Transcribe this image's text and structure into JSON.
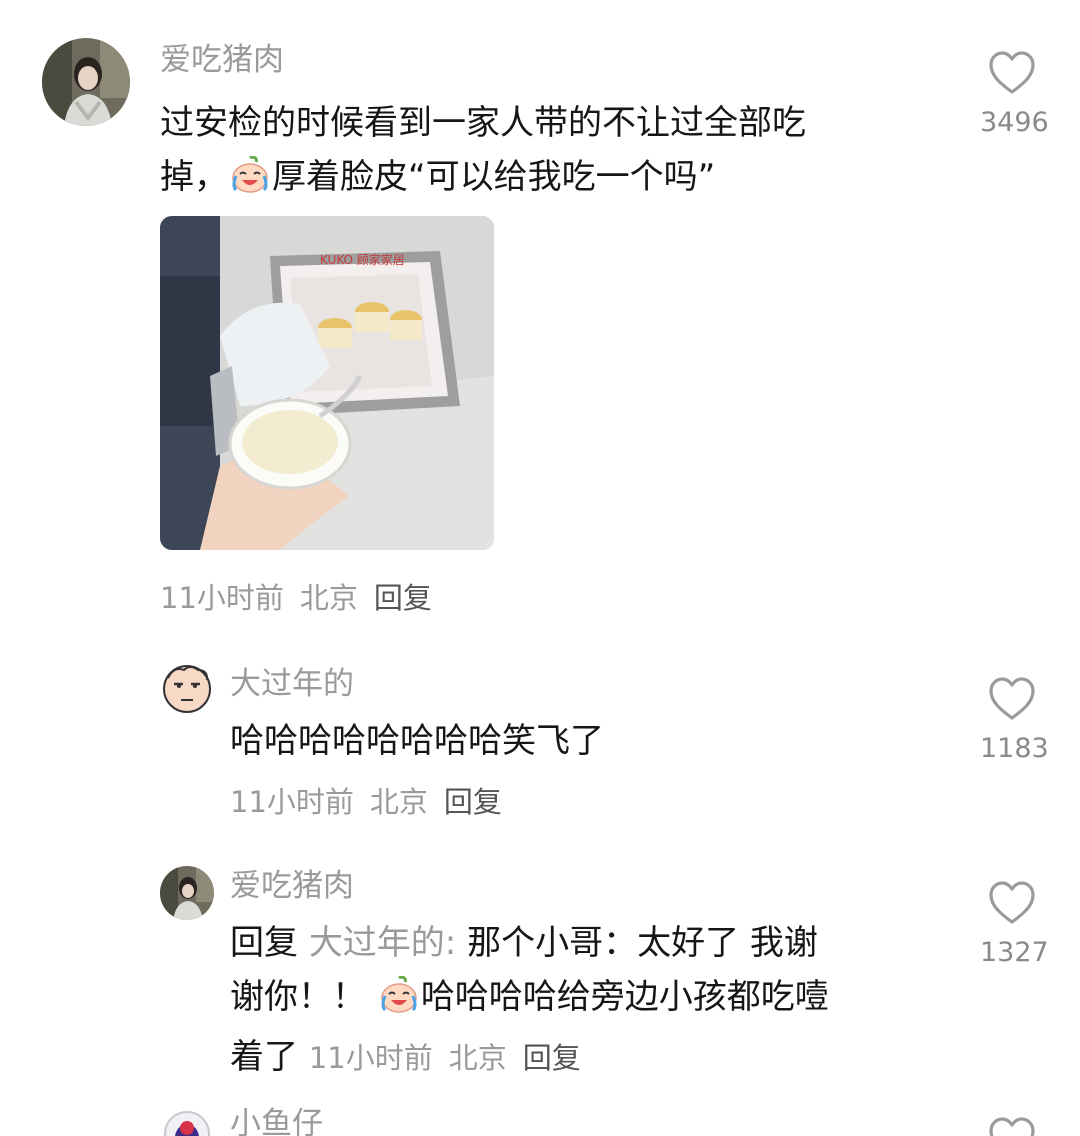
{
  "comments": [
    {
      "username": "爱吃猪肉",
      "text_line1": "过安检的时候看到一家人带的不让过全部吃",
      "text_line2_a": "掉，",
      "text_line2_b": "厚着脸皮“可以给我吃一个吗”",
      "emoji": "crying-laughing-emoji",
      "image": {
        "brand_text": "KUKO 顾家家居"
      },
      "time": "11小时前",
      "location": "北京",
      "reply_label": "回复",
      "likes": "3496"
    }
  ],
  "replies": [
    {
      "username": "大过年的",
      "text": "哈哈哈哈哈哈哈哈笑飞了",
      "time": "11小时前",
      "location": "北京",
      "reply_label": "回复",
      "likes": "1183"
    },
    {
      "username": "爱吃猪肉",
      "reply_prefix": "回复",
      "reply_target": "大过年的:",
      "text_line1": "那个小哥：太好了 我谢",
      "text_line2_a": "谢你！！",
      "text_line2_b": "哈哈哈哈给旁边小孩都吃噎",
      "text_line3": "着了",
      "emoji": "crying-laughing-emoji",
      "time": "11小时前",
      "location": "北京",
      "reply_label": "回复",
      "likes": "1327"
    },
    {
      "username": "小鱼仔"
    }
  ],
  "colors": {
    "username": "#9a9a9a",
    "text": "#161616",
    "meta": "#9a9a9a",
    "like_icon": "#9a9a9a"
  }
}
